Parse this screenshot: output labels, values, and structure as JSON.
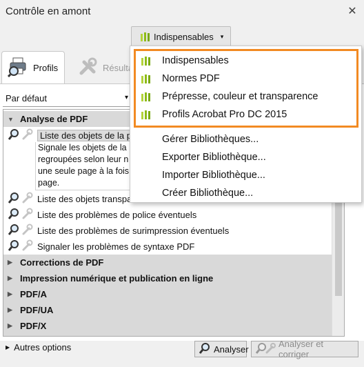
{
  "window": {
    "title": "Contrôle en amont",
    "close_glyph": "✕"
  },
  "library_button": {
    "label": "Indispensables",
    "caret": "▾",
    "icon": "library-bars-icon"
  },
  "tabs": [
    {
      "label": "Profils",
      "icon": "printer-magnifier-icon"
    },
    {
      "label": "Résultats",
      "icon": "wrench-icon"
    }
  ],
  "profile_select": {
    "value": "Par défaut",
    "arrow": "▾"
  },
  "tree": {
    "groups": [
      {
        "label": "Analyse de PDF",
        "expanded": true
      },
      {
        "label": "Corrections de PDF",
        "expanded": false
      },
      {
        "label": "Impression numérique et publication en ligne",
        "expanded": false
      },
      {
        "label": "PDF/A",
        "expanded": false
      },
      {
        "label": "PDF/UA",
        "expanded": false
      },
      {
        "label": "PDF/X",
        "expanded": false
      }
    ],
    "items": [
      "Liste des objets de la p",
      "Liste des objets transpa",
      "Liste des problèmes de police éventuels",
      "Liste des problèmes de surimpression éventuels",
      "Signaler les problèmes de syntaxe PDF"
    ],
    "description_lines": [
      "Signale les objets de la",
      "regroupées selon leur n",
      "une seule page à la fois",
      "page."
    ]
  },
  "menu": {
    "libraries": [
      "Indispensables",
      "Normes PDF",
      "Prépresse, couleur et transparence",
      "Profils Acrobat Pro DC 2015"
    ],
    "actions": [
      "Gérer Bibliothèques...",
      "Exporter Bibliothèque...",
      "Importer Bibliothèque...",
      "Créer Bibliothèque..."
    ]
  },
  "footer": {
    "more_options": "Autres options",
    "analyze": "Analyser",
    "analyze_fix": "Analyser et corriger"
  },
  "colors": {
    "highlight": "#f28a22",
    "library_green": "#9cc31c"
  }
}
